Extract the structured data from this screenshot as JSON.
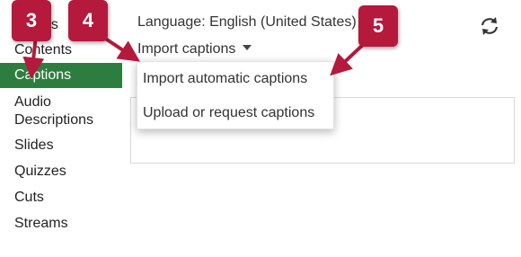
{
  "sidebar": {
    "items": [
      {
        "label": "Details"
      },
      {
        "label": "Contents"
      },
      {
        "label": "Captions"
      },
      {
        "label": "Audio Descriptions"
      },
      {
        "label": "Slides"
      },
      {
        "label": "Quizzes"
      },
      {
        "label": "Cuts"
      },
      {
        "label": "Streams"
      }
    ],
    "active_color": "#2e7d40"
  },
  "header": {
    "language_text": "Language: English (United States)",
    "import_label": "Import captions"
  },
  "dropdown": {
    "options": [
      {
        "label": "Import automatic captions"
      },
      {
        "label": "Upload or request captions"
      }
    ]
  },
  "callouts": {
    "badges": [
      {
        "label": "3"
      },
      {
        "label": "4"
      },
      {
        "label": "5"
      }
    ],
    "color": "#b5193b"
  },
  "icons": {
    "refresh": "refresh-icon"
  }
}
